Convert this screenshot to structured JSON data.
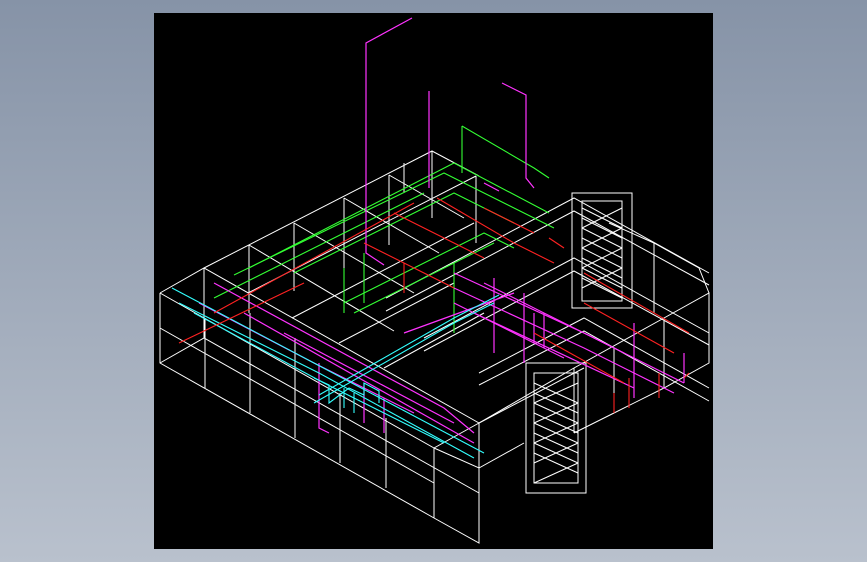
{
  "colors": {
    "background_top": "#8693a7",
    "background_bottom": "#b9c1cd",
    "viewport": "#000000",
    "frame": "#ffffff",
    "green": "#33ff33",
    "magenta": "#ff33ff",
    "cyan": "#33ffff",
    "red": "#ff2222"
  },
  "icons": [
    "wireframe-building-model"
  ]
}
